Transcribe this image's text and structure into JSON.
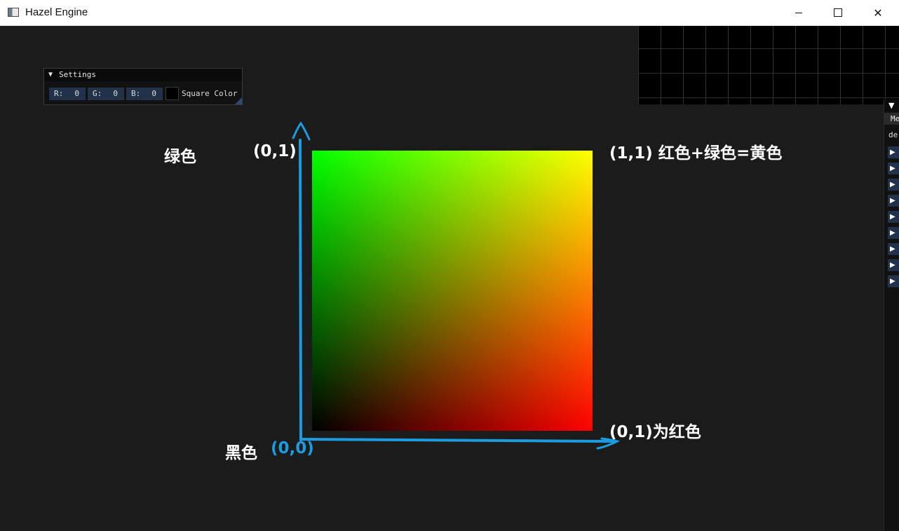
{
  "window": {
    "title": "Hazel Engine",
    "icons": {
      "app": "app-window-icon",
      "minimize": "minimize-icon",
      "maximize": "maximize-icon",
      "close": "close-icon"
    },
    "close_glyph": "✕"
  },
  "settings": {
    "collapse_glyph": "▼",
    "title": "Settings",
    "r_label": "R:",
    "r_value": "0",
    "g_label": "G:",
    "g_value": "0",
    "b_label": "B:",
    "b_value": "0",
    "color_label": "Square Color",
    "square_color": "#000000"
  },
  "annotations": {
    "green": "绿色",
    "top_left": "(0,1)",
    "top_right": "(1,1) 红色+绿色=黄色",
    "bottom_right": "(0,1)为红色",
    "black": "黑色",
    "origin": "(0,0)"
  },
  "right_panel": {
    "header_glyph": "▼",
    "item_me": "Me",
    "item_de": "de",
    "arrow_glyph": "▶"
  },
  "colors": {
    "background": "#1b1b1b",
    "accent_blue": "#1b9be0",
    "corner_bottom_left": "#000000",
    "corner_bottom_right": "#ff0000",
    "corner_top_left": "#00ff00",
    "corner_top_right": "#ffff00"
  }
}
